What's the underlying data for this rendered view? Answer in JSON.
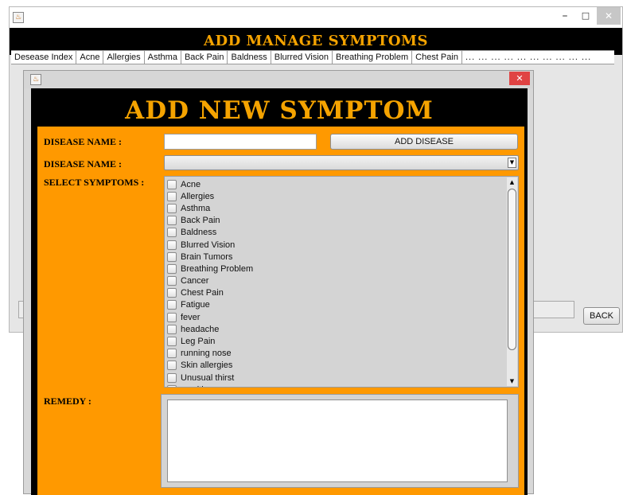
{
  "back_window": {
    "title": "ADD MANAGE SYMPTOMS",
    "controls": {
      "minimize": "–",
      "maximize": "□",
      "close": "✕"
    },
    "columns": [
      "Desease Index",
      "Acne",
      "Allergies",
      "Asthma",
      "Back Pain",
      "Baldness",
      "Blurred Vision",
      "Breathing Problem",
      "Chest Pain"
    ],
    "overflow_columns": "... ... ... ... ... ... ... ... ... ...",
    "back_button": "BACK"
  },
  "dialog": {
    "close": "✕",
    "title": "ADD NEW SYMPTOM",
    "disease_name_label": "DISEASE NAME :",
    "disease_name_value": "",
    "add_disease_button": "ADD DISEASE",
    "disease_select_label": "DISEASE NAME :",
    "disease_select_value": "",
    "select_symptoms_label": "SELECT SYMPTOMS :",
    "symptoms": [
      "Acne",
      "Allergies",
      "Asthma",
      "Back Pain",
      "Baldness",
      "Blurred Vision",
      "Brain Tumors",
      "Breathing Problem",
      "Cancer",
      "Chest Pain",
      "Fatigue",
      "fever",
      "headache",
      "Leg Pain",
      "running nose",
      "Skin allergies",
      "Unusual thirst",
      "vomiting"
    ],
    "remedy_label": "REMEDY :",
    "remedy_value": ""
  },
  "icons": {
    "app": "java-icon",
    "up": "▲",
    "down": "▼"
  },
  "colors": {
    "accent": "#ff9900",
    "title_text": "#f5a300",
    "header_bg": "#000000",
    "close_red": "#e04343"
  }
}
